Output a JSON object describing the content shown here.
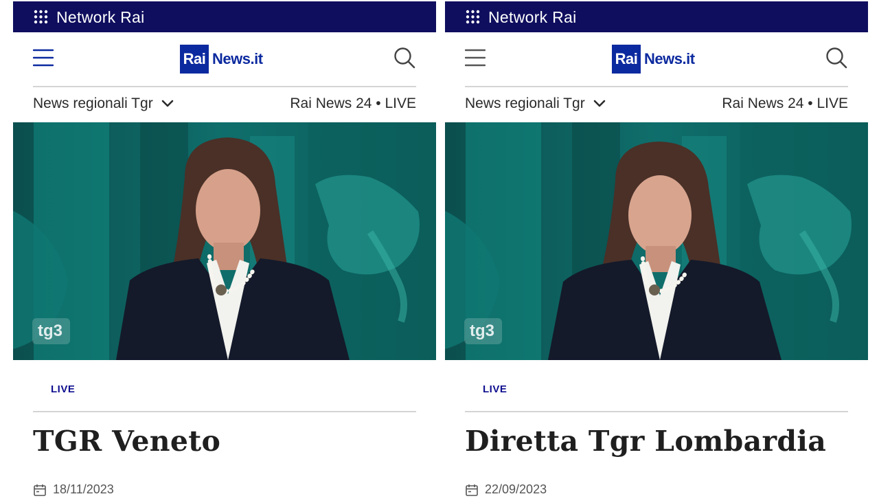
{
  "panels": [
    {
      "network_label": "Network Rai",
      "logo_rai": "Rai",
      "logo_news": "News.it",
      "regional_label": "News regionali Tgr",
      "live_link": "Rai News 24 • LIVE",
      "video_logo": "tg3",
      "live_badge": "LIVE",
      "title": "TGR Veneto",
      "date": "18/11/2023"
    },
    {
      "network_label": "Network Rai",
      "logo_rai": "Rai",
      "logo_news": "News.it",
      "regional_label": "News regionali Tgr",
      "live_link": "Rai News 24 • LIVE",
      "video_logo": "tg3",
      "live_badge": "LIVE",
      "title": "Diretta Tgr Lombardia",
      "date": "22/09/2023"
    }
  ],
  "icons": {
    "apps": "grid-icon",
    "menu": "hamburger-menu-icon",
    "search": "search-icon",
    "dropdown": "chevron-down-icon",
    "calendar": "calendar-icon"
  },
  "colors": {
    "network_bar": "#0f0e5e",
    "brand_blue": "#0c2a9f",
    "live_badge": "#0f0e8f",
    "studio_teal": "#0e5e5d"
  }
}
